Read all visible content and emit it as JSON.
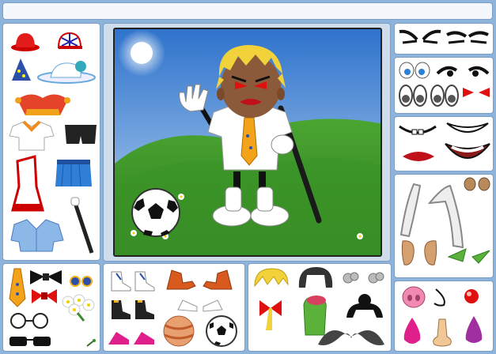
{
  "colors": {
    "background": "#8fb4dc",
    "panel": "#ffffff",
    "panel_border": "#7d9fc6",
    "sky_top": "#3c7fd3",
    "grass": "#3e8f2a",
    "hair": "#f2d23a",
    "body": "#8a5a3b"
  },
  "panels": {
    "top_bar": {
      "text": ""
    },
    "hats": [
      "red-bowler-hat",
      "union-jack-cap",
      "wizard-hat",
      "white-sun-hat",
      "jester-hat"
    ],
    "clothes": [
      "orange-collar-shirt",
      "black-shorts",
      "red-white-dress",
      "blue-skirt",
      "blue-jacket",
      "black-cane"
    ],
    "accessories": [
      "orange-tie",
      "black-bowtie",
      "pearl-earrings",
      "red-bowtie",
      "daisy-bouquet",
      "round-glasses",
      "sunglasses",
      "pin"
    ],
    "footwear": [
      "white-sneakers",
      "elf-shoes",
      "black-shoes",
      "white-flat-shoes",
      "pink-heels",
      "orange-ball",
      "soccer-ball"
    ],
    "hair_items": [
      "blonde-bangs",
      "black-bob",
      "grey-curls",
      "red-bow",
      "green-wig",
      "black-bun",
      "moustache"
    ],
    "eyebrows": [
      "angry-eyebrows",
      "flat-eyebrows"
    ],
    "eyes": [
      "blue-eyes",
      "black-lashes",
      "red-eyes",
      "grey-eyes"
    ],
    "mouths": [
      "toothy-grin",
      "big-smile",
      "red-lips",
      "wide-smile"
    ],
    "ears": [
      "long-ears",
      "small-ears",
      "round-ears",
      "green-elf-ears"
    ],
    "noses": [
      "pig-snout",
      "hook-nose",
      "red-clown-nose",
      "pink-nose",
      "big-nose",
      "purple-nose"
    ]
  }
}
